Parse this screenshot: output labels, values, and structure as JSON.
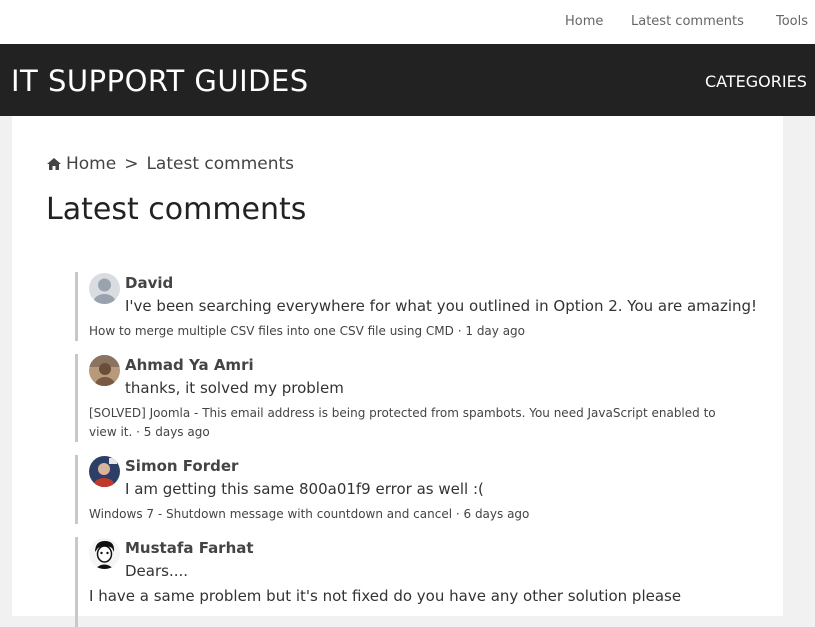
{
  "topnav": {
    "home": "Home",
    "latest_comments": "Latest comments",
    "tools": "Tools"
  },
  "header": {
    "site_title": "IT SUPPORT GUIDES",
    "categories": "CATEGORIES"
  },
  "breadcrumb": {
    "home": "Home",
    "separator": ">",
    "current": "Latest comments"
  },
  "page_title": "Latest comments",
  "comments": [
    {
      "author": "David",
      "text": "I've been searching everywhere for what you outlined in Option 2. You are amazing!",
      "post": "How to merge multiple CSV files into one CSV file using CMD",
      "age": "· 1 day ago",
      "avatar": "default-avatar-icon"
    },
    {
      "author": "Ahmad Ya Amri",
      "text": "thanks, it solved my problem",
      "post": "[SOLVED] Joomla - This email address is being protected from spambots. You need JavaScript enabled to view it.",
      "age": "· 5 days ago",
      "avatar": "user-photo"
    },
    {
      "author": "Simon Forder",
      "text": "I am getting this same 800a01f9 error as well :(",
      "post": "Windows 7 - Shutdown message with countdown and cancel",
      "age": "· 6 days ago",
      "avatar": "user-photo"
    },
    {
      "author": "Mustafa Farhat",
      "text": "Dears....",
      "text2": "I have a same problem but it's not fixed do you have any other solution please",
      "avatar": "user-photo"
    }
  ],
  "colors": {
    "header_bg": "#222222",
    "page_bg": "#f1f1f1",
    "comment_border": "#c8c8c8"
  }
}
